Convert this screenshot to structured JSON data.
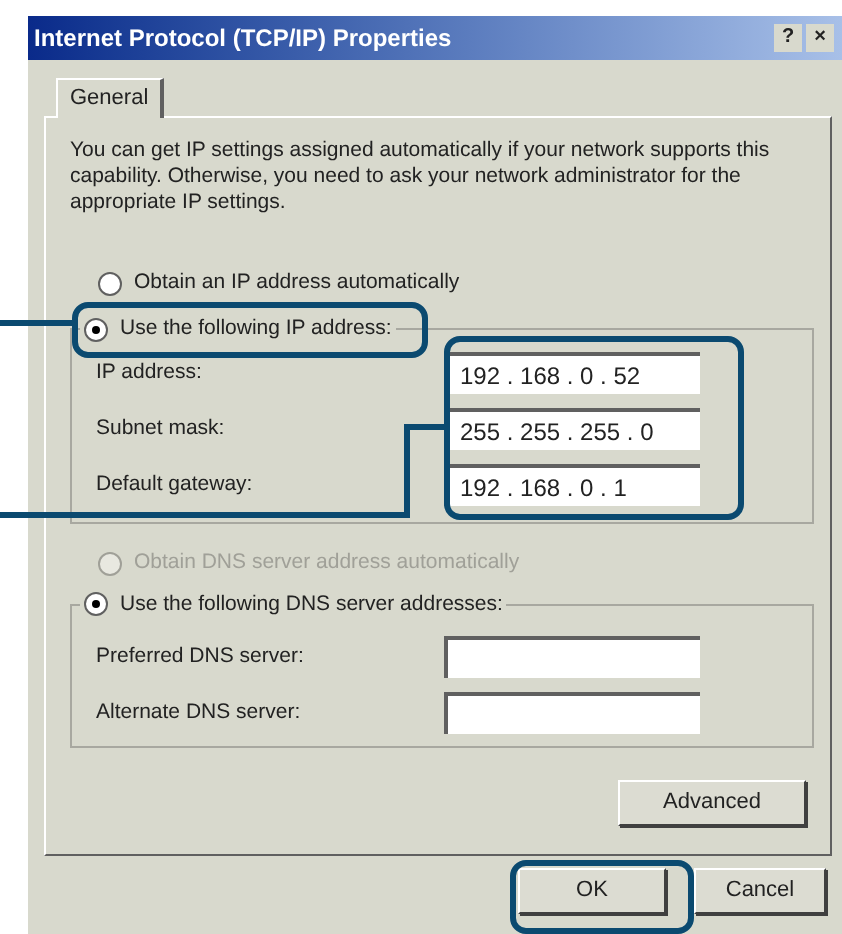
{
  "window": {
    "title": "Internet Protocol (TCP/IP) Properties",
    "help_button": "?",
    "close_button": "×"
  },
  "tabs": [
    {
      "label": "General",
      "selected": true
    }
  ],
  "description": "You can get IP settings assigned automatically if your network supports this capability. Otherwise, you need to ask your network administrator for the appropriate IP settings.",
  "ip_options": [
    {
      "label": "Obtain an IP address automatically",
      "selected": false,
      "disabled": false
    },
    {
      "label": "Use the following IP address:",
      "selected": true,
      "disabled": false
    }
  ],
  "ip_fields": [
    {
      "label": "IP address:",
      "value": "192 . 168 . 0 . 52"
    },
    {
      "label": "Subnet mask:",
      "value": "255 . 255 . 255 . 0"
    },
    {
      "label": "Default gateway:",
      "value": "192 . 168 . 0 . 1"
    }
  ],
  "dns_options": [
    {
      "label": "Obtain DNS server address automatically",
      "selected": false,
      "disabled": true
    },
    {
      "label": "Use the following DNS server addresses:",
      "selected": true,
      "disabled": false
    }
  ],
  "dns_fields": [
    {
      "label": "Preferred DNS server:"
    },
    {
      "label": "Alternate DNS server:"
    }
  ],
  "buttons": {
    "advanced": "Advanced",
    "ok": "OK",
    "cancel": "Cancel"
  }
}
